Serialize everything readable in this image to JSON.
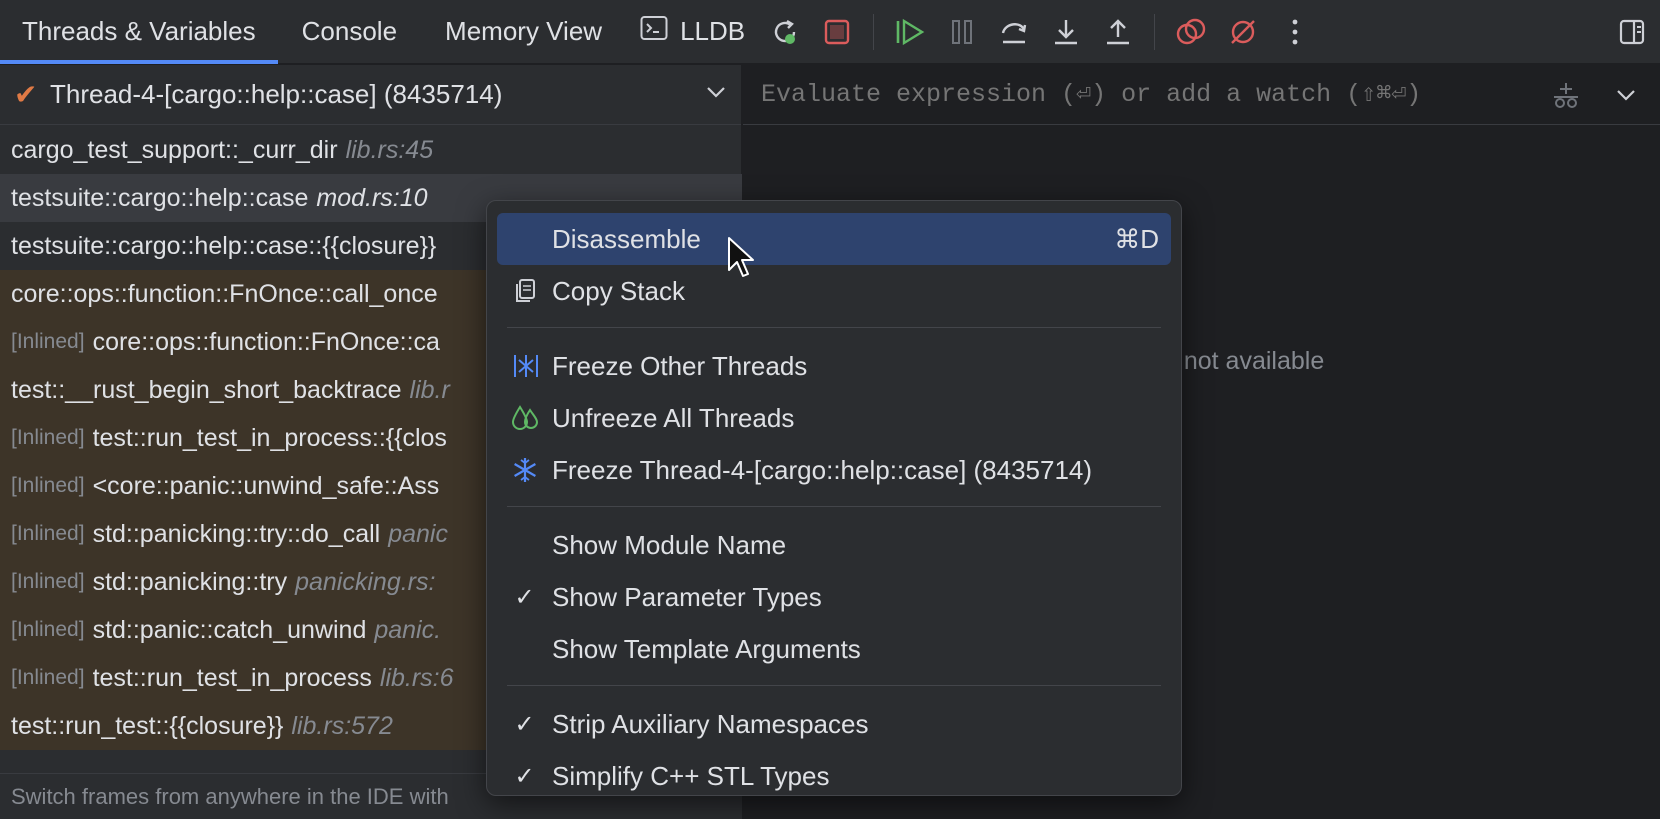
{
  "toolbar": {
    "tabs": [
      {
        "label": "Threads & Variables"
      },
      {
        "label": "Console"
      },
      {
        "label": "Memory View"
      },
      {
        "label": "LLDB"
      }
    ]
  },
  "thread": {
    "name": "Thread-4-[cargo::help::case] (8435714)"
  },
  "frames": [
    {
      "inlined": "",
      "fn": "cargo_test_support::_curr_dir",
      "loc": "lib.rs:45"
    },
    {
      "inlined": "",
      "fn": "testsuite::cargo::help::case",
      "loc": "mod.rs:10"
    },
    {
      "inlined": "",
      "fn": "testsuite::cargo::help::case::{{closure}}",
      "loc": ""
    },
    {
      "inlined": "",
      "fn": "core::ops::function::FnOnce::call_once",
      "loc": ""
    },
    {
      "inlined": "[Inlined]",
      "fn": "core::ops::function::FnOnce::ca",
      "loc": ""
    },
    {
      "inlined": "",
      "fn": "test::__rust_begin_short_backtrace",
      "loc": "lib.r"
    },
    {
      "inlined": "[Inlined]",
      "fn": "test::run_test_in_process::{{clos",
      "loc": ""
    },
    {
      "inlined": "[Inlined]",
      "fn": "<core::panic::unwind_safe::Ass",
      "loc": ""
    },
    {
      "inlined": "[Inlined]",
      "fn": "std::panicking::try::do_call",
      "loc": "panic"
    },
    {
      "inlined": "[Inlined]",
      "fn": "std::panicking::try",
      "loc": "panicking.rs:"
    },
    {
      "inlined": "[Inlined]",
      "fn": "std::panic::catch_unwind",
      "loc": "panic."
    },
    {
      "inlined": "[Inlined]",
      "fn": "test::run_test_in_process",
      "loc": "lib.rs:6"
    },
    {
      "inlined": "",
      "fn": "test::run_test::{{closure}}",
      "loc": "lib.rs:572"
    }
  ],
  "hint": "Switch frames from anywhere in the IDE with",
  "evaluate": {
    "placeholder": "Evaluate expression (⏎) or add a watch (⇧⌘⏎)"
  },
  "right_panel": {
    "unavailable_text": "e not available"
  },
  "menu": {
    "disassemble": {
      "label": "Disassemble",
      "shortcut": "⌘D"
    },
    "copy_stack": {
      "label": "Copy Stack"
    },
    "freeze_other": {
      "label": "Freeze Other Threads"
    },
    "unfreeze_all": {
      "label": "Unfreeze All Threads"
    },
    "freeze_thread": {
      "label": "Freeze Thread-4-[cargo::help::case] (8435714)"
    },
    "show_module": {
      "label": "Show Module Name",
      "checked": false
    },
    "show_param": {
      "label": "Show Parameter Types",
      "checked": true
    },
    "show_template": {
      "label": "Show Template Arguments",
      "checked": false
    },
    "strip_ns": {
      "label": "Strip Auxiliary Namespaces",
      "checked": true
    },
    "simplify_stl": {
      "label": "Simplify C++ STL Types",
      "checked": true
    },
    "check_glyph": "✓"
  },
  "colors": {
    "accent": "#548af7",
    "highlight": "#2e436e",
    "library_frame": "#3d3428",
    "stop_red": "#db5c5c",
    "resume_green": "#5fb865",
    "thread_check": "#e07a45"
  }
}
